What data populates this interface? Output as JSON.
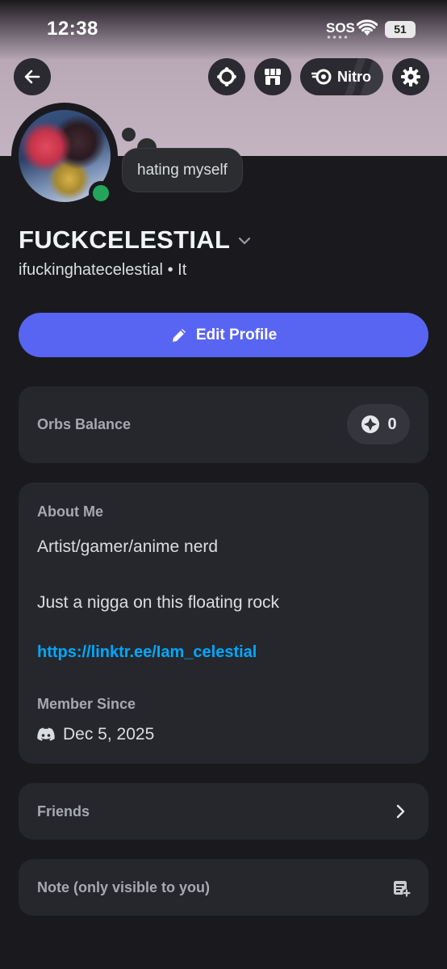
{
  "status_bar": {
    "time": "12:38",
    "sos": "SOS",
    "battery": "51"
  },
  "header": {
    "nitro_label": "Nitro"
  },
  "profile": {
    "custom_status": "hating myself",
    "display_name": "FUCKCELESTIAL",
    "username": "ifuckinghatecelestial",
    "separator": "•",
    "pronouns": "It",
    "online_status_color": "#23a55a"
  },
  "actions": {
    "edit_profile_label": "Edit Profile",
    "accent_color": "#5865f2"
  },
  "orbs": {
    "label": "Orbs Balance",
    "count": "0"
  },
  "about": {
    "heading": "About Me",
    "line1": "Artist/gamer/anime nerd",
    "line2": "Just a nigga on this floating rock",
    "link": "https://linktr.ee/Iam_celestial",
    "member_since_heading": "Member Since",
    "member_since_date": "Dec 5, 2025"
  },
  "friends": {
    "label": "Friends"
  },
  "note": {
    "label": "Note (only visible to you)"
  },
  "icons": [
    "back-arrow-icon",
    "quest-icon",
    "shop-icon",
    "nitro-icon",
    "gear-icon",
    "chevron-down-icon",
    "pencil-icon",
    "orb-icon",
    "discord-logo-icon",
    "chevron-right-icon",
    "note-add-icon",
    "wifi-icon",
    "battery-icon"
  ]
}
